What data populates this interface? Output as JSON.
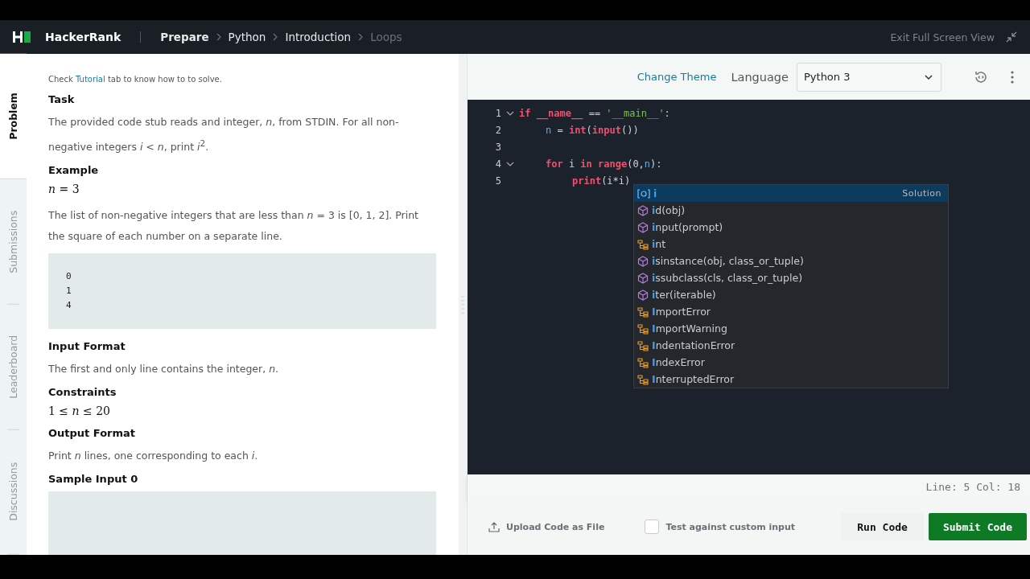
{
  "header": {
    "brand": "HackerRank",
    "breadcrumb": [
      {
        "label": "Prepare",
        "current": false,
        "bold": true
      },
      {
        "label": "Python",
        "current": false,
        "bold": false
      },
      {
        "label": "Introduction",
        "current": false,
        "bold": false
      },
      {
        "label": "Loops",
        "current": true,
        "bold": false
      }
    ],
    "exit_label": "Exit Full Screen View"
  },
  "side_tabs": [
    {
      "label": "Problem",
      "selected": true
    },
    {
      "label": "Submissions",
      "selected": false
    },
    {
      "label": "Leaderboard",
      "selected": false
    },
    {
      "label": "Discussions",
      "selected": false
    }
  ],
  "problem": {
    "hint_before": "Check",
    "hint_link": "Tutorial",
    "hint_after": "tab to know how to to solve.",
    "blocks": [
      {
        "kind": "heading",
        "text": "Task"
      },
      {
        "kind": "para",
        "text": "The provided code stub reads and integer, *n*, from STDIN. For all non-negative integers *i* < *n*, print *i*$^{2}$."
      },
      {
        "kind": "heading",
        "text": "Example"
      },
      {
        "kind": "math",
        "text": "*n* = 3"
      },
      {
        "kind": "para",
        "text": "The list of non-negative integers that are less than *n* = 3 is [0, 1, 2]. Print the square of each number on a separate line."
      },
      {
        "kind": "code",
        "lines": [
          "0",
          "1",
          "4"
        ]
      },
      {
        "kind": "heading",
        "text": "Input Format"
      },
      {
        "kind": "para",
        "text": "The first and only line contains the integer, *n*."
      },
      {
        "kind": "heading",
        "text": "Constraints"
      },
      {
        "kind": "math",
        "text": "1 ≤ *n* ≤ 20"
      },
      {
        "kind": "heading",
        "text": "Output Format"
      },
      {
        "kind": "para",
        "text": "Print *n* lines, one corresponding to each *i*."
      },
      {
        "kind": "heading",
        "text": "Sample Input 0"
      },
      {
        "kind": "code"
      }
    ]
  },
  "toolbar": {
    "change_theme": "Change Theme",
    "language_label": "Language",
    "language": "Python 3"
  },
  "editor": {
    "lines": [
      {
        "number": "1",
        "fold": true,
        "tokens": [
          {
            "kind": "kw",
            "text": "if"
          },
          {
            "kind": "kw",
            "text": "__name__",
            "gap_before": true
          },
          {
            "kind": "plain",
            "text": "==",
            "gap_before": true
          },
          {
            "kind": "str",
            "text": "'__main__'",
            "gap_before": true
          },
          {
            "kind": "plain",
            "text": ":"
          }
        ],
        "children": [
          {
            "number": "2",
            "fold": false,
            "tokens": [
              {
                "kind": "var",
                "text": "n"
              },
              {
                "kind": "plain",
                "text": "=",
                "gap_before": true
              },
              {
                "kind": "kw",
                "text": "int",
                "gap_before": true
              },
              {
                "kind": "plain",
                "text": "("
              },
              {
                "kind": "kw",
                "text": "input"
              },
              {
                "kind": "plain",
                "text": "())"
              }
            ]
          },
          {
            "number": "3",
            "fold": false
          },
          {
            "number": "4",
            "fold": true,
            "tokens": [
              {
                "kind": "kw",
                "text": "for"
              },
              {
                "kind": "plain",
                "text": "i",
                "gap_before": true
              },
              {
                "kind": "kw",
                "text": "in",
                "gap_before": true
              },
              {
                "kind": "kw",
                "text": "range",
                "gap_before": true
              },
              {
                "kind": "plain",
                "text": "(0,"
              },
              {
                "kind": "var",
                "text": "n"
              },
              {
                "kind": "plain",
                "text": "):"
              }
            ],
            "children": [
              {
                "number": "5",
                "fold": false,
                "tokens": [
                  {
                    "kind": "kw",
                    "text": "print"
                  },
                  {
                    "kind": "plain",
                    "text": "(i*i)"
                  }
                ]
              }
            ]
          }
        ]
      }
    ],
    "suggestions": [
      {
        "kind": "variable",
        "label": "i",
        "selected": true,
        "detail": "Solution"
      },
      {
        "kind": "function",
        "label": "id(obj)",
        "selected": false
      },
      {
        "kind": "function",
        "label": "input(prompt)",
        "selected": false
      },
      {
        "kind": "class",
        "label": "int",
        "selected": false
      },
      {
        "kind": "function",
        "label": "isinstance(obj, class_or_tuple)",
        "selected": false
      },
      {
        "kind": "function",
        "label": "issubclass(cls, class_or_tuple)",
        "selected": false
      },
      {
        "kind": "function",
        "label": "iter(iterable)",
        "selected": false
      },
      {
        "kind": "class",
        "label": "ImportError",
        "selected": false
      },
      {
        "kind": "class",
        "label": "ImportWarning",
        "selected": false
      },
      {
        "kind": "class",
        "label": "IndentationError",
        "selected": false
      },
      {
        "kind": "class",
        "label": "IndexError",
        "selected": false
      },
      {
        "kind": "class",
        "label": "InterruptedError",
        "selected": false
      }
    ],
    "status": "Line: 5 Col: 18"
  },
  "footer": {
    "upload": "Upload Code as File",
    "custom_input": {
      "label": "Test against custom input",
      "checked": false
    },
    "run": "Run Code",
    "submit": "Submit Code"
  }
}
